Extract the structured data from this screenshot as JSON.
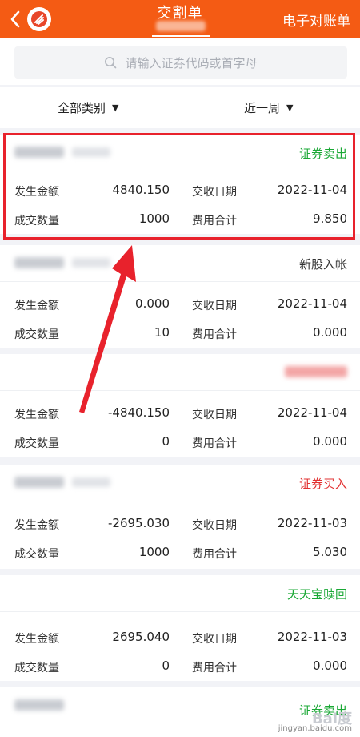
{
  "header": {
    "title": "交割单",
    "statement_label": "电子对账单"
  },
  "search": {
    "placeholder": "请输入证券代码或首字母"
  },
  "filters": {
    "category": "全部类别",
    "period": "近一周"
  },
  "labels": {
    "amount": "发生金额",
    "quantity": "成交数量",
    "settle_date": "交收日期",
    "fee_total": "费用合计"
  },
  "cards": [
    {
      "type": "证券卖出",
      "type_color": "green",
      "amount": "4840.150",
      "quantity": "1000",
      "settle_date": "2022-11-04",
      "fee_total": "9.850"
    },
    {
      "type": "新股入帐",
      "type_color": "gray",
      "amount": "0.000",
      "quantity": "10",
      "settle_date": "2022-11-04",
      "fee_total": "0.000"
    },
    {
      "type": "",
      "type_color": "red",
      "amount": "-4840.150",
      "quantity": "0",
      "settle_date": "2022-11-04",
      "fee_total": "0.000"
    },
    {
      "type": "证券买入",
      "type_color": "red",
      "amount": "-2695.030",
      "quantity": "1000",
      "settle_date": "2022-11-03",
      "fee_total": "5.030"
    },
    {
      "type": "天天宝赎回",
      "type_color": "green",
      "amount": "2695.040",
      "quantity": "0",
      "settle_date": "2022-11-03",
      "fee_total": "0.000"
    },
    {
      "type": "证券卖出",
      "type_color": "green"
    }
  ],
  "colors": {
    "brand": "#f45b14",
    "highlight": "#e8222c",
    "buy": "#e23030",
    "sell": "#1aa835"
  },
  "watermark": {
    "brand": "Bai度",
    "site": "jingyan.baidu.com"
  }
}
